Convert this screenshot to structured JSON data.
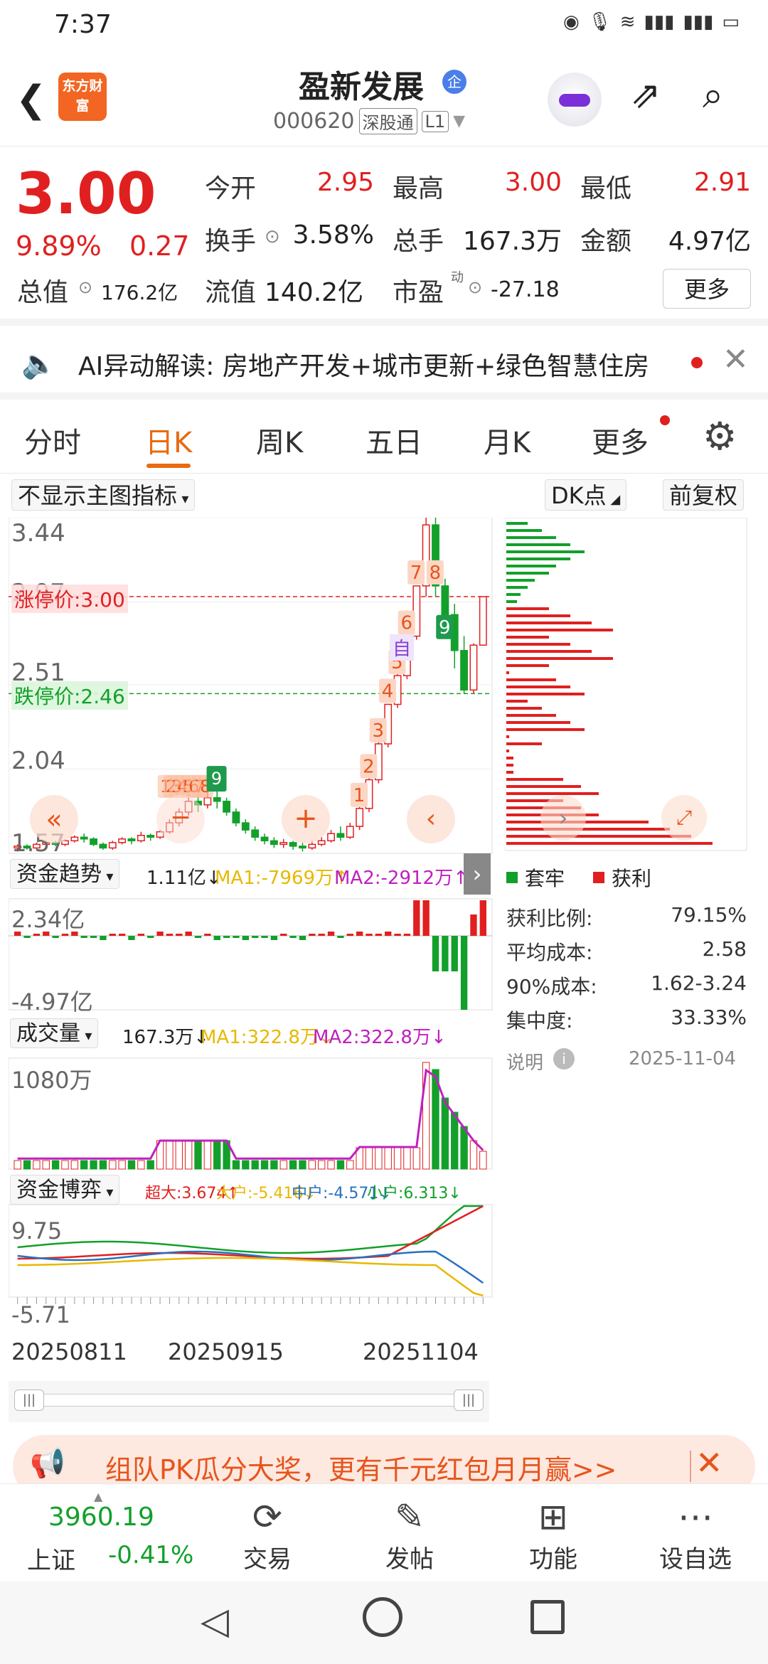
{
  "status": {
    "time": "7:37",
    "icons": [
      "eye-icon",
      "mic-icon",
      "wifi-icon",
      "signal-4g-icon",
      "signal-4g-icon",
      "battery-charging-icon"
    ]
  },
  "header": {
    "name": "盈新发展",
    "badge": "企",
    "code": "000620",
    "tag1": "深股通",
    "tag2": "L1",
    "logo": "东方财富"
  },
  "quote": {
    "price": "3.00",
    "change_pct": "9.89%",
    "change": "0.27",
    "open_label": "今开",
    "open": "2.95",
    "high_label": "最高",
    "high": "3.00",
    "low_label": "最低",
    "low": "2.91",
    "turnover_label": "换手",
    "turnover": "3.58%",
    "volume_label": "总手",
    "volume": "167.3万",
    "amount_label": "金额",
    "amount": "4.97亿",
    "mcap_label": "总值",
    "mcap": "176.2亿",
    "float_label": "流值",
    "float": "140.2亿",
    "pe_label": "市盈",
    "pe_sup": "动",
    "pe": "-27.18",
    "more": "更多"
  },
  "ai": {
    "text": "AI异动解读:  房地产开发+城市更新+绿色智慧住房"
  },
  "tabs": [
    "分时",
    "日K",
    "周K",
    "五日",
    "月K",
    "更多"
  ],
  "chart": {
    "main_indicator": "不显示主图指标",
    "dk": "DK点",
    "adjust": "前复权",
    "y_top": "3.44",
    "y_mid1": "2.97",
    "y_mid2": "2.51",
    "y_mid3": "2.04",
    "y_bot": "1.57",
    "limit_up": "涨停价:3.00",
    "limit_down": "跌停价:2.46",
    "auto_label": "自",
    "date1": "20250811",
    "date2": "20250915",
    "date3": "20251104"
  },
  "chart_data": {
    "type": "candlestick",
    "ylim": [
      1.57,
      3.44
    ],
    "candles": [
      [
        1.6,
        1.61,
        1.58,
        1.62
      ],
      [
        1.61,
        1.6,
        1.59,
        1.62
      ],
      [
        1.6,
        1.62,
        1.59,
        1.63
      ],
      [
        1.62,
        1.63,
        1.61,
        1.64
      ],
      [
        1.63,
        1.62,
        1.61,
        1.64
      ],
      [
        1.62,
        1.64,
        1.61,
        1.65
      ],
      [
        1.64,
        1.66,
        1.63,
        1.67
      ],
      [
        1.66,
        1.65,
        1.63,
        1.68
      ],
      [
        1.65,
        1.62,
        1.61,
        1.66
      ],
      [
        1.62,
        1.6,
        1.59,
        1.63
      ],
      [
        1.6,
        1.63,
        1.59,
        1.64
      ],
      [
        1.63,
        1.65,
        1.62,
        1.66
      ],
      [
        1.65,
        1.64,
        1.62,
        1.66
      ],
      [
        1.64,
        1.67,
        1.63,
        1.69
      ],
      [
        1.67,
        1.66,
        1.64,
        1.68
      ],
      [
        1.66,
        1.69,
        1.65,
        1.7
      ],
      [
        1.69,
        1.74,
        1.68,
        1.76
      ],
      [
        1.74,
        1.8,
        1.72,
        1.82
      ],
      [
        1.8,
        1.86,
        1.78,
        1.9
      ],
      [
        1.86,
        1.84,
        1.8,
        1.92
      ],
      [
        1.84,
        1.88,
        1.82,
        1.93
      ],
      [
        1.88,
        1.86,
        1.82,
        1.94
      ],
      [
        1.86,
        1.8,
        1.78,
        1.88
      ],
      [
        1.8,
        1.74,
        1.72,
        1.82
      ],
      [
        1.74,
        1.7,
        1.68,
        1.76
      ],
      [
        1.7,
        1.66,
        1.64,
        1.72
      ],
      [
        1.66,
        1.64,
        1.62,
        1.68
      ],
      [
        1.64,
        1.62,
        1.6,
        1.66
      ],
      [
        1.62,
        1.63,
        1.6,
        1.65
      ],
      [
        1.63,
        1.61,
        1.59,
        1.64
      ],
      [
        1.61,
        1.6,
        1.58,
        1.63
      ],
      [
        1.6,
        1.62,
        1.59,
        1.64
      ],
      [
        1.62,
        1.64,
        1.61,
        1.66
      ],
      [
        1.64,
        1.68,
        1.63,
        1.7
      ],
      [
        1.68,
        1.66,
        1.64,
        1.72
      ],
      [
        1.66,
        1.72,
        1.65,
        1.74
      ],
      [
        1.72,
        1.82,
        1.7,
        1.84
      ],
      [
        1.82,
        1.98,
        1.8,
        1.99
      ],
      [
        1.98,
        2.18,
        1.96,
        2.19
      ],
      [
        2.18,
        2.4,
        2.16,
        2.4
      ],
      [
        2.4,
        2.56,
        2.38,
        2.62
      ],
      [
        2.56,
        2.78,
        2.54,
        2.82
      ],
      [
        2.78,
        3.06,
        2.76,
        3.06
      ],
      [
        3.06,
        3.4,
        3.0,
        3.44
      ],
      [
        3.4,
        3.06,
        3.0,
        3.44
      ],
      [
        3.06,
        2.9,
        2.78,
        3.1
      ],
      [
        2.9,
        2.7,
        2.6,
        2.96
      ],
      [
        2.7,
        2.48,
        2.46,
        2.78
      ],
      [
        2.48,
        2.73,
        2.46,
        2.74
      ],
      [
        2.73,
        3.0,
        2.91,
        3.0
      ]
    ],
    "markers_main": [
      "1",
      "2",
      "3",
      "4",
      "5",
      "6",
      "7",
      "8",
      "9"
    ],
    "markers_early": [
      "1",
      "2",
      "3",
      "4",
      "5",
      "6",
      "7",
      "8",
      "9"
    ],
    "capital_trend": {
      "label": "资金趋势",
      "value": "1.11亿↓",
      "ma1": "MA1:-7969万↑",
      "ma2": "MA2:-2912万↑",
      "ymax": "2.34亿",
      "ymin": "-4.97亿"
    },
    "volume": {
      "label": "成交量",
      "value": "167.3万↓",
      "ma1": "MA1:322.8万↓",
      "ma2": "MA2:322.8万↓",
      "ymax": "1080万"
    },
    "capital_game": {
      "label": "资金博弈",
      "super": "超大:3.674↑",
      "big": "大户:-5.416↓",
      "mid": "中户:-4.571↓",
      "small": "小户:6.313↓",
      "ymax": "9.75",
      "ymin": "-5.71"
    }
  },
  "chip": {
    "legend_trap": "套牢",
    "legend_profit": "获利",
    "rows": [
      [
        "获利比例:",
        "79.15%"
      ],
      [
        "平均成本:",
        "2.58"
      ],
      [
        "90%成本:",
        "1.62-3.24"
      ],
      [
        "集中度:",
        "33.33%"
      ]
    ],
    "note": "说明",
    "date": "2025-11-04"
  },
  "banner": {
    "text": "组队PK瓜分大奖，更有千元红包月月赢>>"
  },
  "bottom": {
    "index_name": "上证",
    "index_val": "3960.19",
    "index_chg": "-0.41%",
    "items": [
      "交易",
      "发帖",
      "功能",
      "设自选"
    ]
  },
  "colors": {
    "up": "#e02020",
    "down": "#12a02a",
    "accent": "#e86a12",
    "ma1": "#e8b800",
    "ma2": "#c020c0"
  }
}
